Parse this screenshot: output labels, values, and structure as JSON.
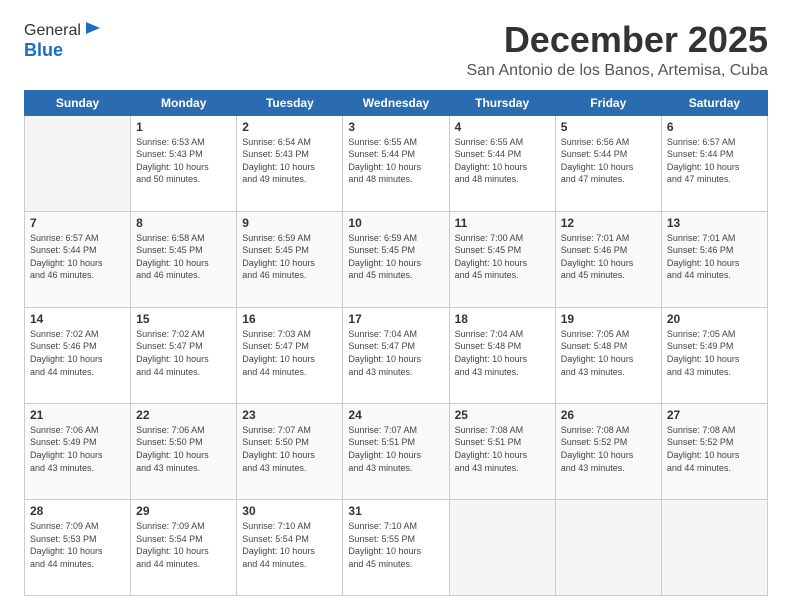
{
  "logo": {
    "general": "General",
    "blue": "Blue"
  },
  "header": {
    "month": "December 2025",
    "location": "San Antonio de los Banos, Artemisa, Cuba"
  },
  "weekdays": [
    "Sunday",
    "Monday",
    "Tuesday",
    "Wednesday",
    "Thursday",
    "Friday",
    "Saturday"
  ],
  "weeks": [
    [
      {
        "num": "",
        "info": ""
      },
      {
        "num": "1",
        "info": "Sunrise: 6:53 AM\nSunset: 5:43 PM\nDaylight: 10 hours\nand 50 minutes."
      },
      {
        "num": "2",
        "info": "Sunrise: 6:54 AM\nSunset: 5:43 PM\nDaylight: 10 hours\nand 49 minutes."
      },
      {
        "num": "3",
        "info": "Sunrise: 6:55 AM\nSunset: 5:44 PM\nDaylight: 10 hours\nand 48 minutes."
      },
      {
        "num": "4",
        "info": "Sunrise: 6:55 AM\nSunset: 5:44 PM\nDaylight: 10 hours\nand 48 minutes."
      },
      {
        "num": "5",
        "info": "Sunrise: 6:56 AM\nSunset: 5:44 PM\nDaylight: 10 hours\nand 47 minutes."
      },
      {
        "num": "6",
        "info": "Sunrise: 6:57 AM\nSunset: 5:44 PM\nDaylight: 10 hours\nand 47 minutes."
      }
    ],
    [
      {
        "num": "7",
        "info": "Sunrise: 6:57 AM\nSunset: 5:44 PM\nDaylight: 10 hours\nand 46 minutes."
      },
      {
        "num": "8",
        "info": "Sunrise: 6:58 AM\nSunset: 5:45 PM\nDaylight: 10 hours\nand 46 minutes."
      },
      {
        "num": "9",
        "info": "Sunrise: 6:59 AM\nSunset: 5:45 PM\nDaylight: 10 hours\nand 46 minutes."
      },
      {
        "num": "10",
        "info": "Sunrise: 6:59 AM\nSunset: 5:45 PM\nDaylight: 10 hours\nand 45 minutes."
      },
      {
        "num": "11",
        "info": "Sunrise: 7:00 AM\nSunset: 5:45 PM\nDaylight: 10 hours\nand 45 minutes."
      },
      {
        "num": "12",
        "info": "Sunrise: 7:01 AM\nSunset: 5:46 PM\nDaylight: 10 hours\nand 45 minutes."
      },
      {
        "num": "13",
        "info": "Sunrise: 7:01 AM\nSunset: 5:46 PM\nDaylight: 10 hours\nand 44 minutes."
      }
    ],
    [
      {
        "num": "14",
        "info": "Sunrise: 7:02 AM\nSunset: 5:46 PM\nDaylight: 10 hours\nand 44 minutes."
      },
      {
        "num": "15",
        "info": "Sunrise: 7:02 AM\nSunset: 5:47 PM\nDaylight: 10 hours\nand 44 minutes."
      },
      {
        "num": "16",
        "info": "Sunrise: 7:03 AM\nSunset: 5:47 PM\nDaylight: 10 hours\nand 44 minutes."
      },
      {
        "num": "17",
        "info": "Sunrise: 7:04 AM\nSunset: 5:47 PM\nDaylight: 10 hours\nand 43 minutes."
      },
      {
        "num": "18",
        "info": "Sunrise: 7:04 AM\nSunset: 5:48 PM\nDaylight: 10 hours\nand 43 minutes."
      },
      {
        "num": "19",
        "info": "Sunrise: 7:05 AM\nSunset: 5:48 PM\nDaylight: 10 hours\nand 43 minutes."
      },
      {
        "num": "20",
        "info": "Sunrise: 7:05 AM\nSunset: 5:49 PM\nDaylight: 10 hours\nand 43 minutes."
      }
    ],
    [
      {
        "num": "21",
        "info": "Sunrise: 7:06 AM\nSunset: 5:49 PM\nDaylight: 10 hours\nand 43 minutes."
      },
      {
        "num": "22",
        "info": "Sunrise: 7:06 AM\nSunset: 5:50 PM\nDaylight: 10 hours\nand 43 minutes."
      },
      {
        "num": "23",
        "info": "Sunrise: 7:07 AM\nSunset: 5:50 PM\nDaylight: 10 hours\nand 43 minutes."
      },
      {
        "num": "24",
        "info": "Sunrise: 7:07 AM\nSunset: 5:51 PM\nDaylight: 10 hours\nand 43 minutes."
      },
      {
        "num": "25",
        "info": "Sunrise: 7:08 AM\nSunset: 5:51 PM\nDaylight: 10 hours\nand 43 minutes."
      },
      {
        "num": "26",
        "info": "Sunrise: 7:08 AM\nSunset: 5:52 PM\nDaylight: 10 hours\nand 43 minutes."
      },
      {
        "num": "27",
        "info": "Sunrise: 7:08 AM\nSunset: 5:52 PM\nDaylight: 10 hours\nand 44 minutes."
      }
    ],
    [
      {
        "num": "28",
        "info": "Sunrise: 7:09 AM\nSunset: 5:53 PM\nDaylight: 10 hours\nand 44 minutes."
      },
      {
        "num": "29",
        "info": "Sunrise: 7:09 AM\nSunset: 5:54 PM\nDaylight: 10 hours\nand 44 minutes."
      },
      {
        "num": "30",
        "info": "Sunrise: 7:10 AM\nSunset: 5:54 PM\nDaylight: 10 hours\nand 44 minutes."
      },
      {
        "num": "31",
        "info": "Sunrise: 7:10 AM\nSunset: 5:55 PM\nDaylight: 10 hours\nand 45 minutes."
      },
      {
        "num": "",
        "info": ""
      },
      {
        "num": "",
        "info": ""
      },
      {
        "num": "",
        "info": ""
      }
    ]
  ]
}
